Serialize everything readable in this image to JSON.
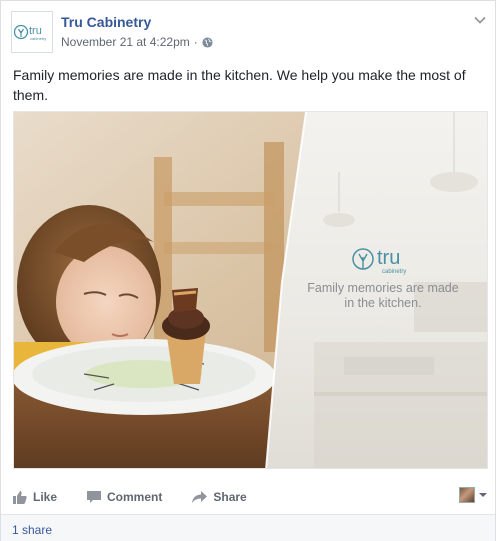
{
  "post": {
    "page_name": "Tru Cabinetry",
    "timestamp": "November 21 at 4:22pm",
    "separator": "·",
    "privacy_icon": "globe-icon",
    "message": "Family memories are made in the kitchen. We help you make the most of them."
  },
  "avatar_logo": {
    "brand": "tru",
    "sub": "cabinetry"
  },
  "photo": {
    "overlay_brand": "tru",
    "overlay_brand_sub": "cabinetry",
    "overlay_tagline_line1": "Family memories are made",
    "overlay_tagline_line2": "in the kitchen."
  },
  "actions": {
    "like_label": "Like",
    "comment_label": "Comment",
    "share_label": "Share"
  },
  "footer": {
    "shares_text": "1 share"
  },
  "colors": {
    "link_blue": "#365899",
    "brand_teal": "#4a90a4",
    "meta_gray": "#616770"
  }
}
